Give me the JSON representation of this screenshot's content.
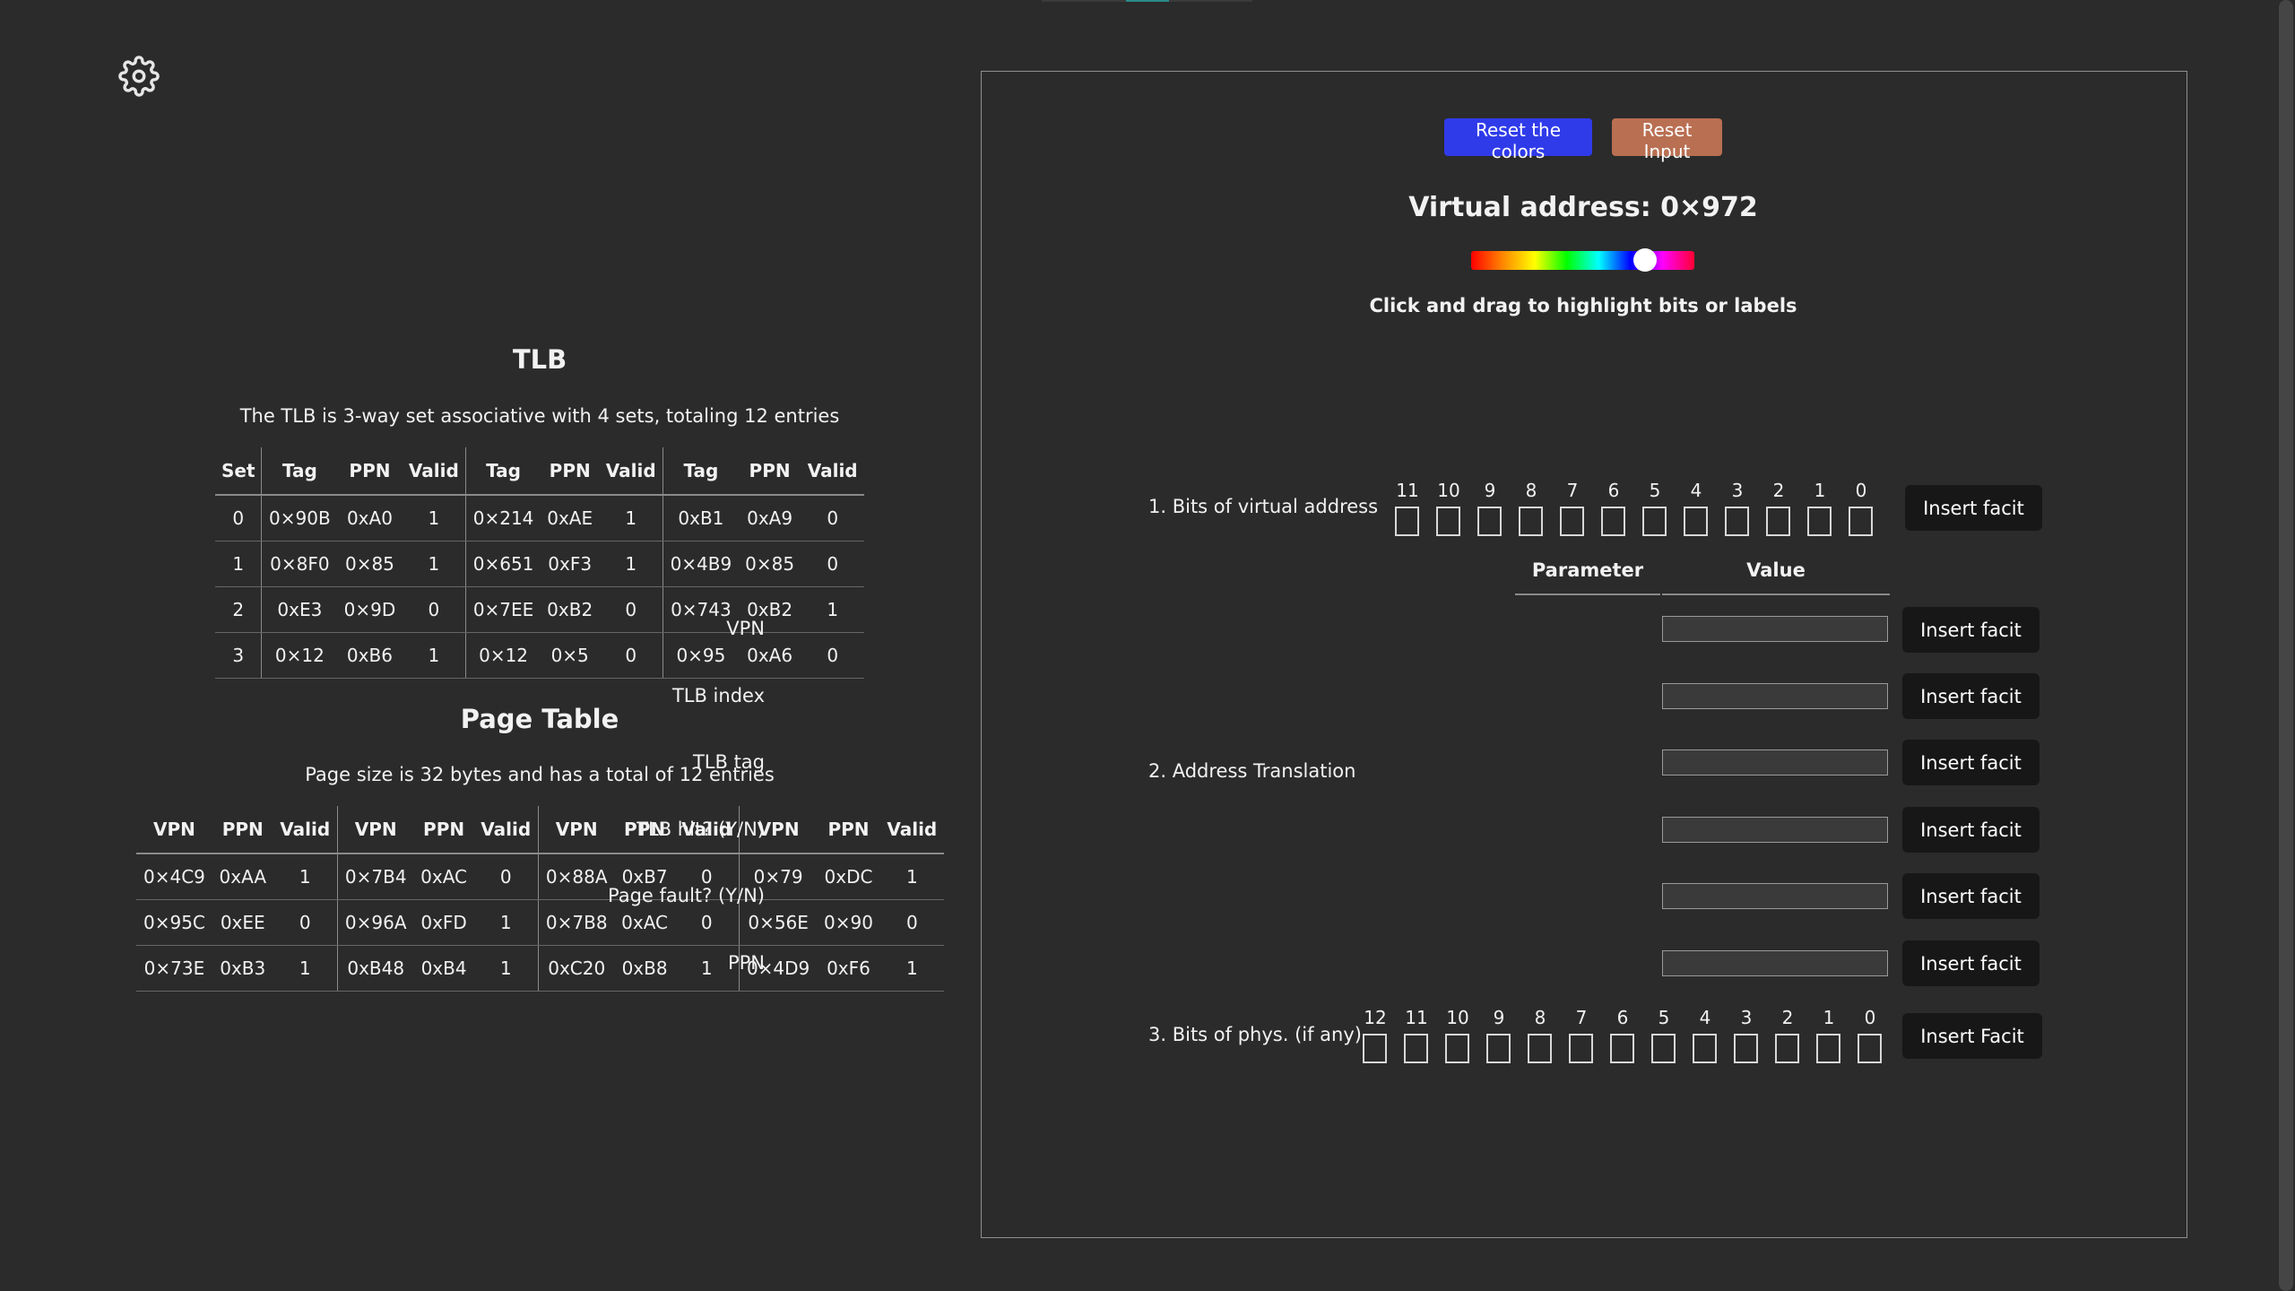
{
  "settings": {
    "icon": "gear-icon"
  },
  "tlb": {
    "title": "TLB",
    "description": "The TLB is 3-way set associative with 4 sets, totaling 12 entries",
    "headers": [
      "Set",
      "Tag",
      "PPN",
      "Valid",
      "Tag",
      "PPN",
      "Valid",
      "Tag",
      "PPN",
      "Valid"
    ],
    "rows": [
      [
        "0",
        "0×90B",
        "0xA0",
        "1",
        "0×214",
        "0xAE",
        "1",
        "0xB1",
        "0xA9",
        "0"
      ],
      [
        "1",
        "0×8F0",
        "0×85",
        "1",
        "0×651",
        "0xF3",
        "1",
        "0×4B9",
        "0×85",
        "0"
      ],
      [
        "2",
        "0xE3",
        "0×9D",
        "0",
        "0×7EE",
        "0xB2",
        "0",
        "0×743",
        "0xB2",
        "1"
      ],
      [
        "3",
        "0×12",
        "0xB6",
        "1",
        "0×12",
        "0×5",
        "0",
        "0×95",
        "0xA6",
        "0"
      ]
    ]
  },
  "page_table": {
    "title": "Page Table",
    "description": "Page size is 32 bytes and has a total of 12 entries",
    "headers": [
      "VPN",
      "PPN",
      "Valid",
      "VPN",
      "PPN",
      "Valid",
      "VPN",
      "PPN",
      "Valid",
      "VPN",
      "PPN",
      "Valid"
    ],
    "rows": [
      [
        "0×4C9",
        "0xAA",
        "1",
        "0×7B4",
        "0xAC",
        "0",
        "0×88A",
        "0xB7",
        "0",
        "0×79",
        "0xDC",
        "1"
      ],
      [
        "0×95C",
        "0xEE",
        "0",
        "0×96A",
        "0xFD",
        "1",
        "0×7B8",
        "0xAC",
        "0",
        "0×56E",
        "0×90",
        "0"
      ],
      [
        "0×73E",
        "0xB3",
        "1",
        "0xB48",
        "0xB4",
        "1",
        "0xC20",
        "0xB8",
        "1",
        "0×4D9",
        "0xF6",
        "1"
      ]
    ]
  },
  "controls": {
    "reset_colors": "Reset the colors",
    "reset_input": "Reset Input",
    "virtual_address": "Virtual address: 0×972",
    "hint": "Click and drag to highlight bits or labels",
    "hue_value": 0.78
  },
  "va_section": {
    "label": "1. Bits of virtual address",
    "bits": [
      "11",
      "10",
      "9",
      "8",
      "7",
      "6",
      "5",
      "4",
      "3",
      "2",
      "1",
      "0"
    ],
    "insert": "Insert facit"
  },
  "translation": {
    "label": "2. Address Translation",
    "param_header": "Parameter",
    "value_header": "Value",
    "params": [
      {
        "name": "VPN",
        "insert": "Insert facit",
        "value": ""
      },
      {
        "name": "TLB index",
        "insert": "Insert facit",
        "value": ""
      },
      {
        "name": "TLB tag",
        "insert": "Insert facit",
        "value": ""
      },
      {
        "name": "TLB hit? (Y/N)",
        "insert": "Insert facit",
        "value": ""
      },
      {
        "name": "Page fault? (Y/N)",
        "insert": "Insert facit",
        "value": ""
      },
      {
        "name": "PPN",
        "insert": "Insert facit",
        "value": ""
      }
    ]
  },
  "pa_section": {
    "label": "3. Bits of phys. (if any)",
    "bits": [
      "12",
      "11",
      "10",
      "9",
      "8",
      "7",
      "6",
      "5",
      "4",
      "3",
      "2",
      "1",
      "0"
    ],
    "insert": "Insert Facit"
  }
}
